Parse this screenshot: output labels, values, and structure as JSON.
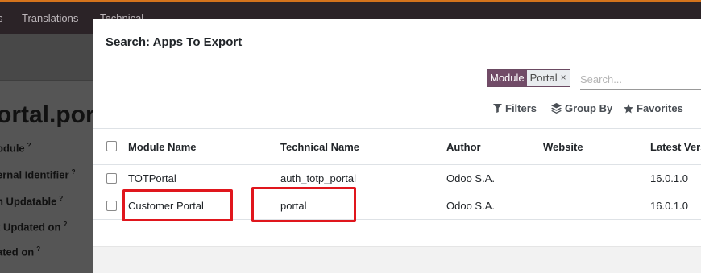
{
  "topbar": {
    "nav_items": [
      "s",
      "Translations",
      "Technical"
    ]
  },
  "background": {
    "record_title": "ortal.por",
    "fields": [
      "odule",
      "ernal Identifier",
      "n Updatable",
      "t Updated on",
      "ated on"
    ],
    "help_mark": "?"
  },
  "modal": {
    "title": "Search: Apps To Export",
    "search": {
      "facet_label": "Module",
      "facet_value": "Portal",
      "facet_remove": "×",
      "placeholder": "Search..."
    },
    "toolbar": {
      "filters": "Filters",
      "group_by": "Group By",
      "favorites": "Favorites"
    },
    "table": {
      "columns": [
        "Module Name",
        "Technical Name",
        "Author",
        "Website",
        "Latest Vers"
      ],
      "rows": [
        {
          "module_name": "TOTPortal",
          "technical_name": "auth_totp_portal",
          "author": "Odoo S.A.",
          "website": "",
          "latest_version": "16.0.1.0"
        },
        {
          "module_name": "Customer Portal",
          "technical_name": "portal",
          "author": "Odoo S.A.",
          "website": "",
          "latest_version": "16.0.1.0"
        }
      ]
    }
  },
  "colors": {
    "accent_orange": "#d4731c",
    "facet_purple": "#714b67",
    "highlight_red": "#e0161d"
  }
}
